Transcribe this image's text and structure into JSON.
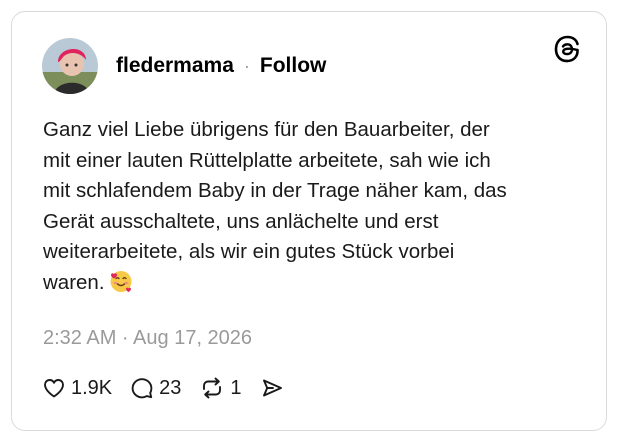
{
  "post": {
    "username": "fledermama",
    "separator": "·",
    "follow_label": "Follow",
    "text_lines": [
      "Ganz viel Liebe übrigens für den Bauarbeiter, der",
      "mit einer lauten Rüttelplatte arbeitete, sah wie ich",
      "mit schlafendem Baby in der Trage näher kam, das",
      "Gerät ausschaltete, uns anlächelte und erst",
      "weiterarbeitete, als wir ein gutes Stück vorbei",
      "waren."
    ],
    "emoji": "smiling-face-with-hearts",
    "timestamp": "2:32 AM · Aug 17, 2026"
  },
  "actions": {
    "likes": "1.9K",
    "replies": "23",
    "reposts": "1"
  },
  "icons": {
    "logo": "threads-icon",
    "like": "heart-icon",
    "reply": "speech-bubble-icon",
    "repost": "repost-icon",
    "share": "send-icon"
  },
  "colors": {
    "text": "#1a1a1a",
    "muted": "#9a9a9a",
    "border": "#d9d9d9",
    "avatar_hair": "#e0245e"
  }
}
